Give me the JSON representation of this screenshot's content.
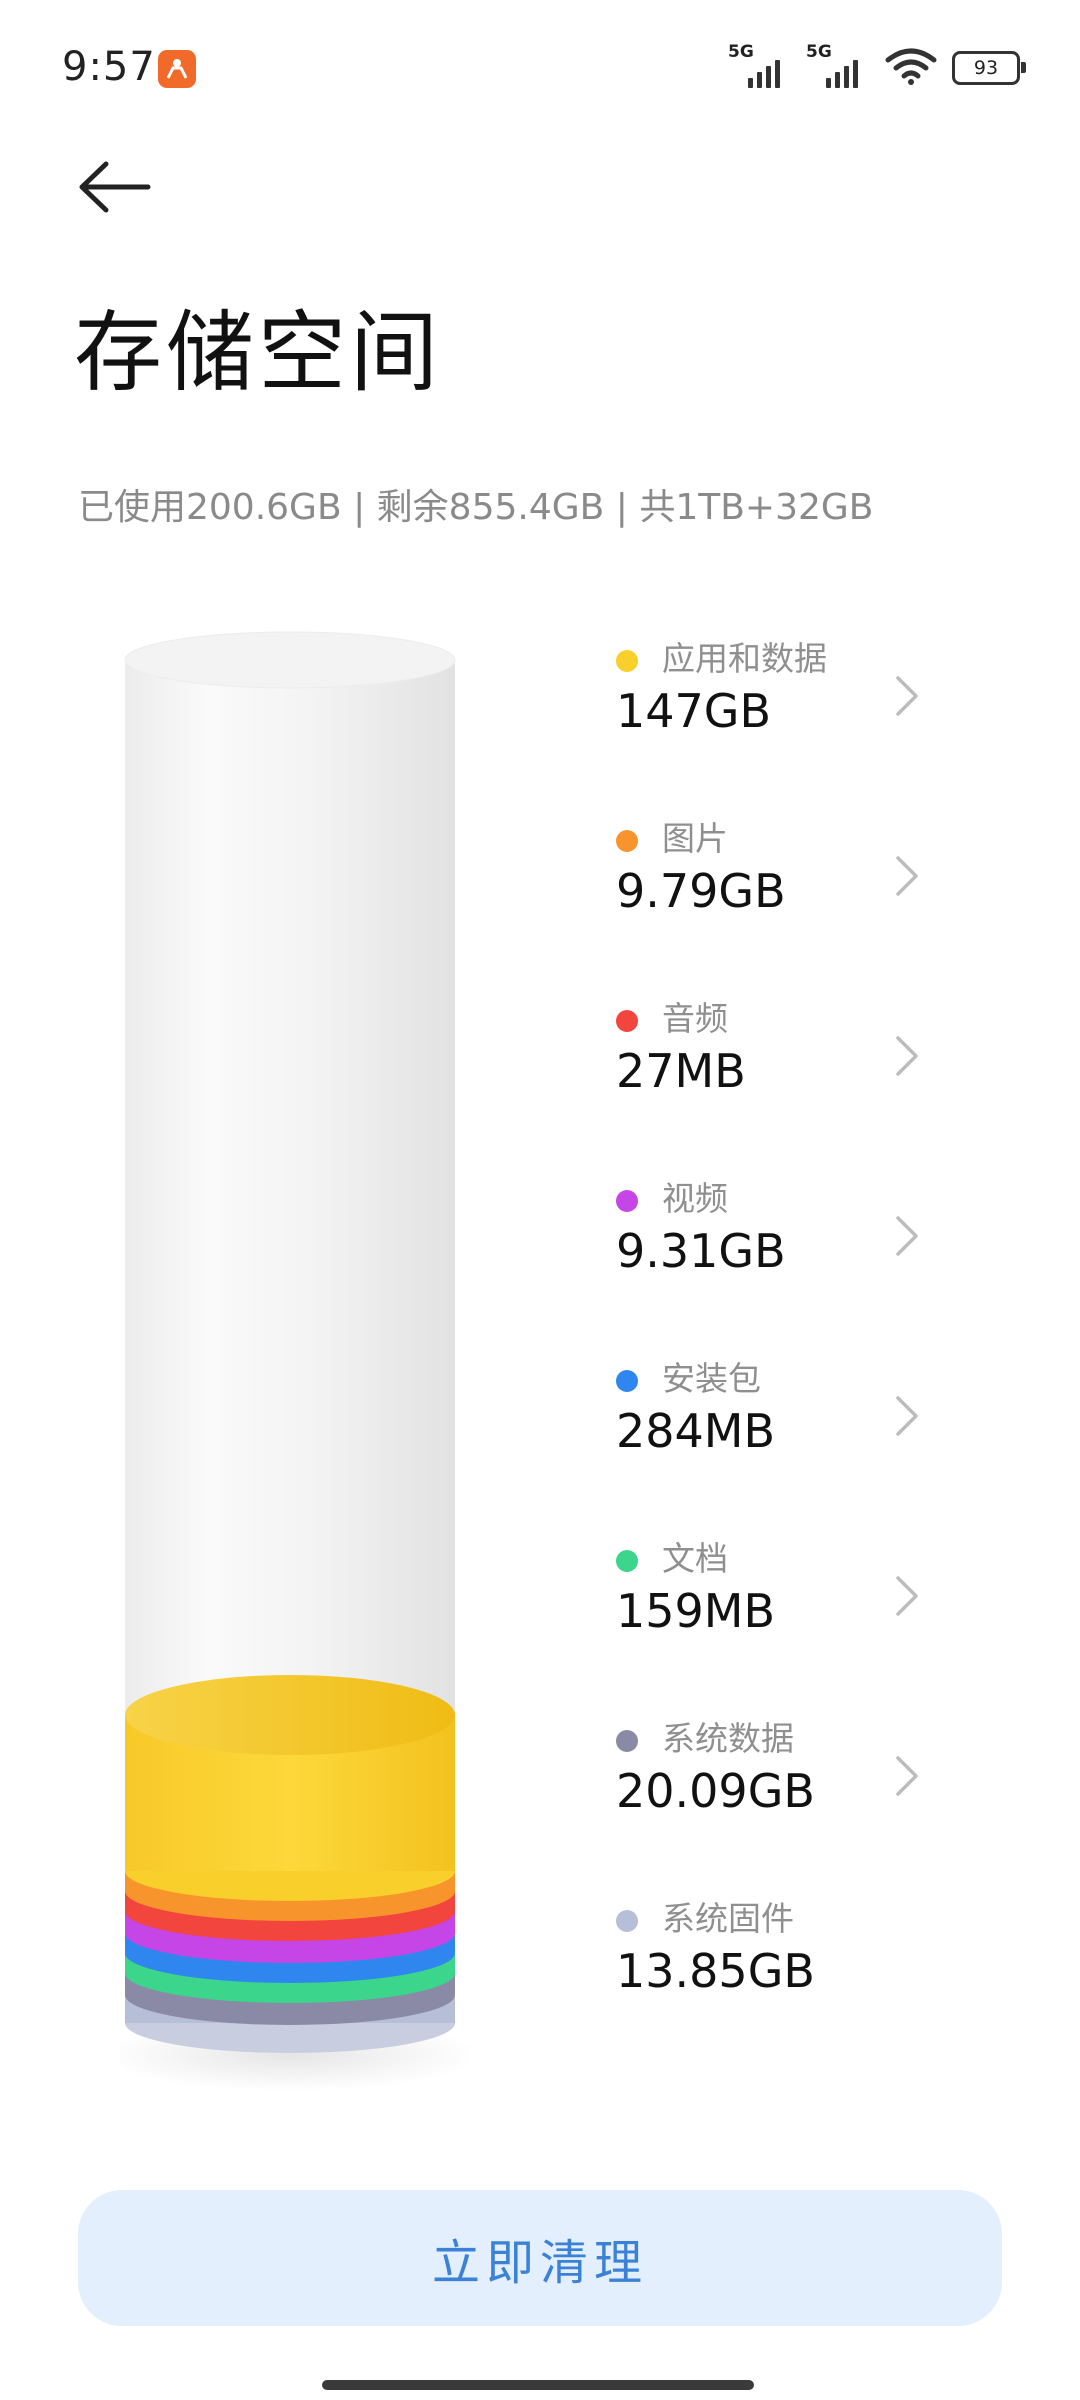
{
  "status_bar": {
    "time": "9:57",
    "network1": "5G",
    "network2": "5G",
    "battery": "93"
  },
  "page": {
    "title": "存储空间",
    "summary": "已使用200.6GB | 剩余855.4GB | 共1TB+32GB"
  },
  "categories": [
    {
      "label": "应用和数据",
      "value": "147GB",
      "color": "#f9cf2c",
      "has_arrow": true
    },
    {
      "label": "图片",
      "value": "9.79GB",
      "color": "#f7952c",
      "has_arrow": true
    },
    {
      "label": "音频",
      "value": "27MB",
      "color": "#f2453d",
      "has_arrow": true
    },
    {
      "label": "视频",
      "value": "9.31GB",
      "color": "#c645e6",
      "has_arrow": true
    },
    {
      "label": "安装包",
      "value": "284MB",
      "color": "#2f86ef",
      "has_arrow": true
    },
    {
      "label": "文档",
      "value": "159MB",
      "color": "#3bd58c",
      "has_arrow": true
    },
    {
      "label": "系统数据",
      "value": "20.09GB",
      "color": "#8a8aa6",
      "has_arrow": true
    },
    {
      "label": "系统固件",
      "value": "13.85GB",
      "color": "#b7bfd8",
      "has_arrow": false
    }
  ],
  "actions": {
    "clean_label": "立即清理"
  },
  "icons": {
    "back": "arrow-left-icon",
    "chevron": "chevron-right-icon",
    "wifi": "wifi-icon",
    "battery": "battery-icon",
    "app_badge": "app-notification-icon"
  }
}
